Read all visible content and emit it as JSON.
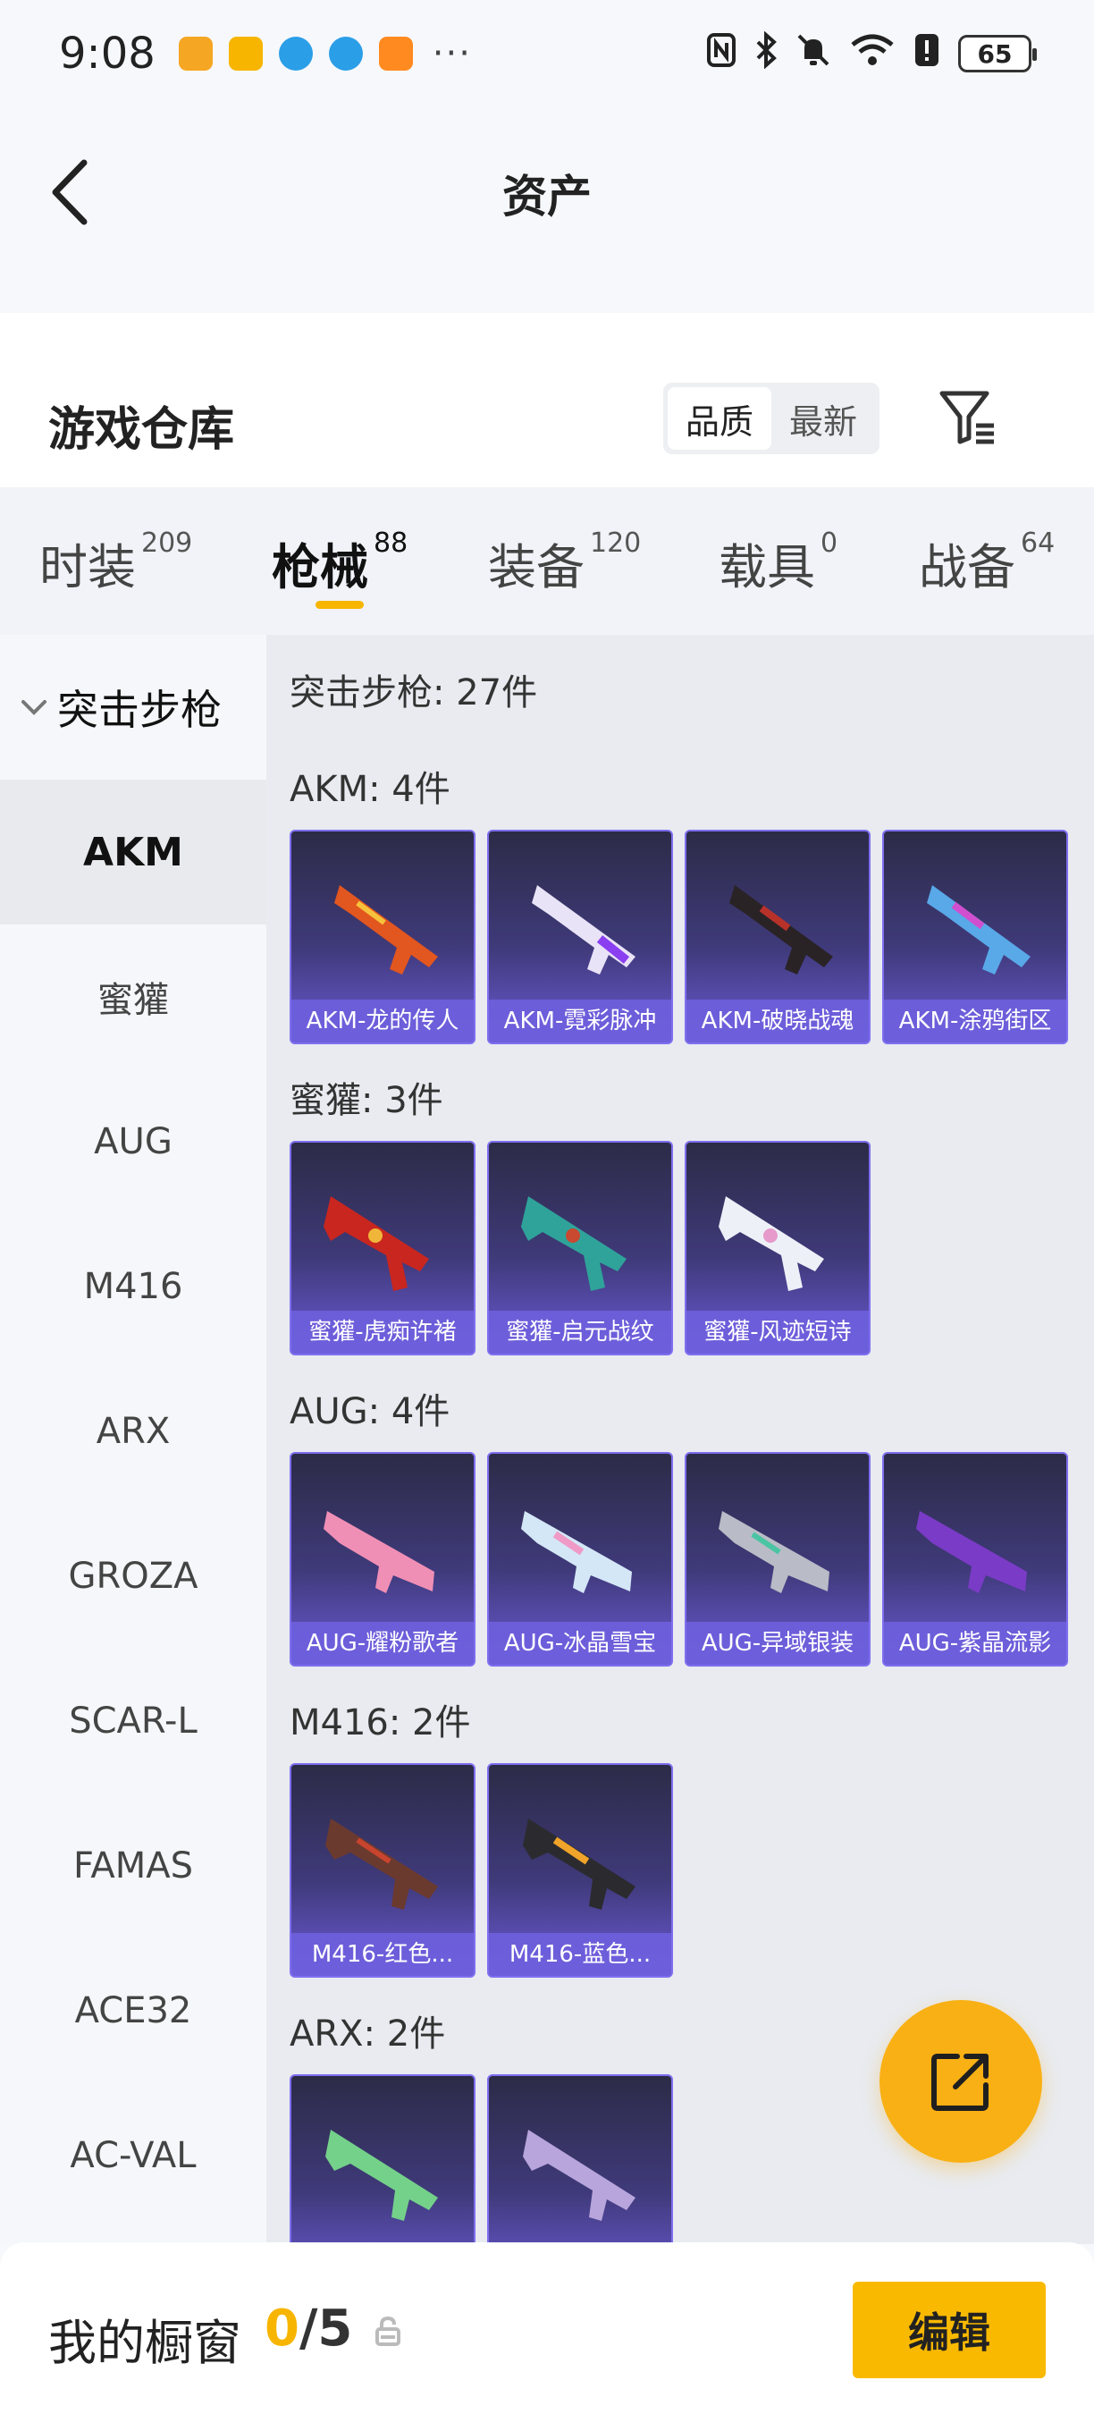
{
  "status_bar": {
    "time": "9:08",
    "battery": "65",
    "more": "···"
  },
  "header": {
    "title": "资产"
  },
  "warehouse": {
    "title": "游戏仓库",
    "sort_options": [
      "品质",
      "最新"
    ],
    "active_sort": "品质"
  },
  "tabs": [
    {
      "label": "时装",
      "count": "209"
    },
    {
      "label": "枪械",
      "count": "88"
    },
    {
      "label": "装备",
      "count": "120"
    },
    {
      "label": "载具",
      "count": "0"
    },
    {
      "label": "战备",
      "count": "64"
    }
  ],
  "active_tab": "枪械",
  "sidebar": {
    "group": "突击步枪",
    "items": [
      "AKM",
      "蜜獾",
      "AUG",
      "M416",
      "ARX",
      "GROZA",
      "SCAR-L",
      "FAMAS",
      "ACE32",
      "AC-VAL"
    ],
    "active": "AKM"
  },
  "content": {
    "total": "突击步枪: 27件",
    "sections": [
      {
        "title": "AKM: 4件",
        "items": [
          "AKM-龙的传人",
          "AKM-霓彩脉冲",
          "AKM-破晓战魂",
          "AKM-涂鸦街区"
        ]
      },
      {
        "title": "蜜獾: 3件",
        "items": [
          "蜜獾-虎痴许褚",
          "蜜獾-启元战纹",
          "蜜獾-风迹短诗"
        ]
      },
      {
        "title": "AUG: 4件",
        "items": [
          "AUG-耀粉歌者",
          "AUG-冰晶雪宝",
          "AUG-异域银装",
          "AUG-紫晶流影"
        ]
      },
      {
        "title": "M416: 2件",
        "items": [
          "M416-红色...",
          "M416-蓝色..."
        ]
      },
      {
        "title": "ARX: 2件",
        "items": [
          "",
          ""
        ]
      }
    ]
  },
  "bottom": {
    "title": "我的橱窗",
    "current": "0",
    "separator": "/",
    "max": "5",
    "edit_label": "编辑"
  },
  "colors": {
    "accent": "#f9b900",
    "card_border": "#7e6ff0"
  }
}
